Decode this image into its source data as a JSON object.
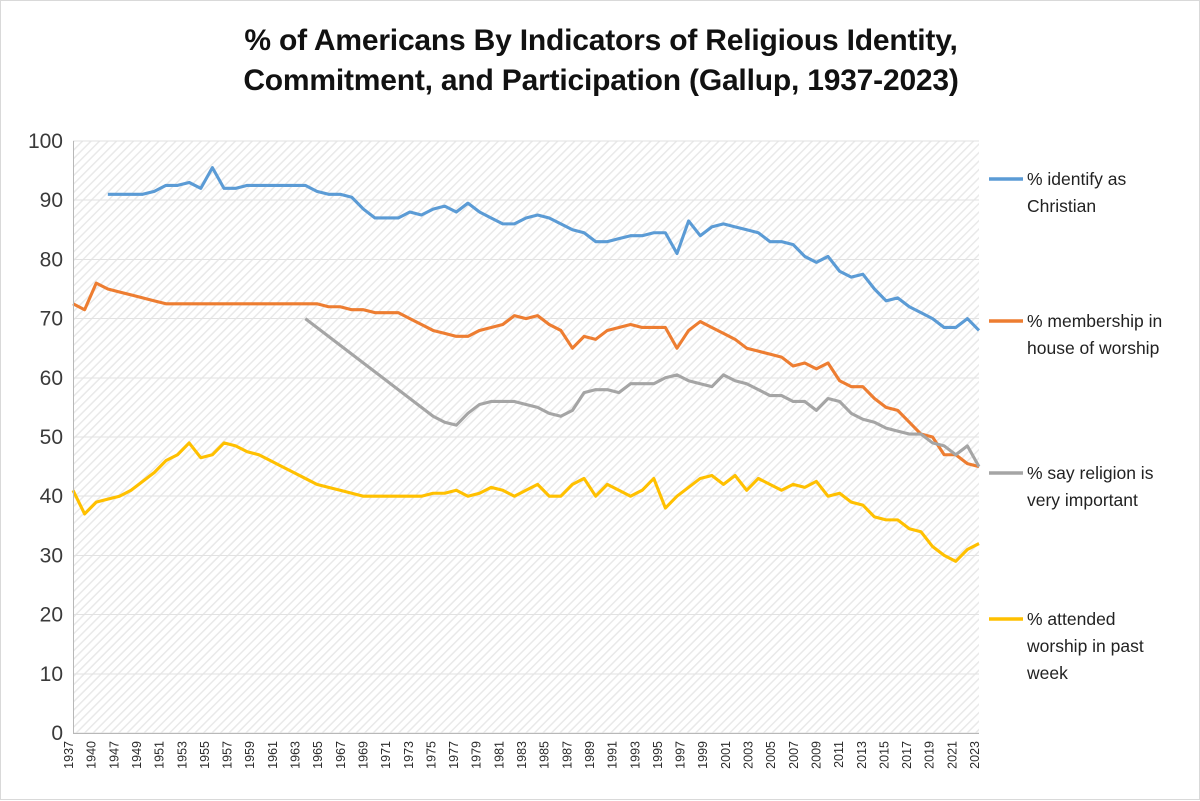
{
  "chart_data": {
    "type": "line",
    "title": "% of Americans By Indicators of Religious Identity,\nCommitment, and Participation (Gallup, 1937-2023)",
    "title_line1": "% of Americans By Indicators of Religious Identity,",
    "title_line2": "Commitment, and Participation (Gallup, 1937-2023)",
    "xlabel": "",
    "ylabel": "",
    "ylim": [
      0,
      100
    ],
    "ytick_step": 10,
    "yticks": [
      "0",
      "10",
      "20",
      "30",
      "40",
      "50",
      "60",
      "70",
      "80",
      "90",
      "100"
    ],
    "grid": true,
    "legend_position": "right",
    "background_pattern": "diagonal-hatch",
    "x_tick_labels": [
      "1937",
      "1940",
      "1947",
      "1949",
      "1951",
      "1953",
      "1955",
      "1957",
      "1959",
      "1961",
      "1963",
      "1965",
      "1967",
      "1969",
      "1971",
      "1973",
      "1975",
      "1977",
      "1979",
      "1981",
      "1983",
      "1985",
      "1987",
      "1989",
      "1991",
      "1993",
      "1995",
      "1997",
      "1999",
      "2001",
      "2003",
      "2005",
      "2007",
      "2009",
      "2011",
      "2013",
      "2015",
      "2017",
      "2019",
      "2021",
      "2023"
    ],
    "x": [
      1937,
      1940,
      1947,
      1948,
      1949,
      1950,
      1951,
      1952,
      1953,
      1954,
      1955,
      1956,
      1957,
      1958,
      1959,
      1960,
      1961,
      1962,
      1963,
      1964,
      1965,
      1966,
      1967,
      1968,
      1969,
      1970,
      1971,
      1972,
      1973,
      1974,
      1975,
      1976,
      1977,
      1978,
      1979,
      1980,
      1981,
      1982,
      1983,
      1984,
      1985,
      1986,
      1987,
      1988,
      1989,
      1990,
      1991,
      1992,
      1993,
      1994,
      1995,
      1996,
      1997,
      1998,
      1999,
      2000,
      2001,
      2002,
      2003,
      2004,
      2005,
      2006,
      2007,
      2008,
      2009,
      2010,
      2011,
      2012,
      2013,
      2014,
      2015,
      2016,
      2017,
      2018,
      2019,
      2020,
      2021,
      2022,
      2023
    ],
    "series": [
      {
        "name": "% identify as Christian",
        "color": "#5B9BD5",
        "x_start": 1948,
        "values": [
          null,
          null,
          null,
          91,
          91,
          91,
          91,
          91.5,
          92.5,
          92.5,
          93,
          92,
          95.5,
          92,
          92,
          92.5,
          92.5,
          92.5,
          92.5,
          92.5,
          92.5,
          91.5,
          91,
          91,
          90.5,
          88.5,
          87,
          87,
          87,
          88,
          87.5,
          88.5,
          89,
          88,
          89.5,
          88,
          87,
          86,
          86,
          87,
          87.5,
          87,
          86,
          85,
          84.5,
          83,
          83,
          83.5,
          84,
          84,
          84.5,
          84.5,
          81,
          86.5,
          84,
          85.5,
          86,
          85.5,
          85,
          84.5,
          83,
          83,
          82.5,
          80.5,
          79.5,
          80.5,
          78,
          77,
          77.5,
          75,
          73,
          73.5,
          72,
          71,
          70,
          68.5,
          68.5,
          70,
          68
        ]
      },
      {
        "name": "% membership in house of worship",
        "color": "#ED7D31",
        "x_start": 1937,
        "values": [
          72.5,
          71.5,
          76,
          75,
          74.5,
          74,
          73.5,
          73,
          72.5,
          72.5,
          72.5,
          72.5,
          72.5,
          72.5,
          72.5,
          72.5,
          72.5,
          72.5,
          72.5,
          72.5,
          72.5,
          72.5,
          72,
          72,
          71.5,
          71.5,
          71,
          71,
          71,
          70,
          69,
          68,
          67.5,
          67,
          67,
          68,
          68.5,
          69,
          70.5,
          70,
          70.5,
          69,
          68,
          65,
          67,
          66.5,
          68,
          68.5,
          69,
          68.5,
          68.5,
          68.5,
          65,
          68,
          69.5,
          68.5,
          67.5,
          66.5,
          65,
          64.5,
          64,
          63.5,
          62,
          62.5,
          61.5,
          62.5,
          59.5,
          58.5,
          58.5,
          56.5,
          55,
          54.5,
          52.5,
          50.5,
          50,
          47,
          47,
          45.5,
          45
        ]
      },
      {
        "name": "% say religion is very important",
        "color": "#A5A5A5",
        "x_start": 1965,
        "values": [
          null,
          null,
          null,
          null,
          null,
          null,
          null,
          null,
          null,
          null,
          null,
          null,
          null,
          null,
          null,
          null,
          null,
          null,
          null,
          null,
          70,
          68.5,
          67,
          65.5,
          64,
          62.5,
          61,
          59.5,
          58,
          56.5,
          55,
          53.5,
          52.5,
          52,
          54,
          55.5,
          56,
          56,
          56,
          55.5,
          55,
          54,
          53.5,
          54.5,
          57.5,
          58,
          58,
          57.5,
          59,
          59,
          59,
          60,
          60.5,
          59.5,
          59,
          58.5,
          60.5,
          59.5,
          59,
          58,
          57,
          57,
          56,
          56,
          54.5,
          56.5,
          56,
          54,
          53,
          52.5,
          51.5,
          51,
          50.5,
          50.5,
          49,
          48.5,
          47,
          48.5,
          45
        ]
      },
      {
        "name": "% attended worship in past week",
        "color": "#FFC000",
        "x_start": 1937,
        "values": [
          41,
          37,
          39,
          39.5,
          40,
          41,
          42.5,
          44,
          46,
          47,
          49,
          46.5,
          47,
          49,
          48.5,
          47.5,
          47,
          46,
          45,
          44,
          43,
          42,
          41.5,
          41,
          40.5,
          40,
          40,
          40,
          40,
          40,
          40,
          40.5,
          40.5,
          41,
          40,
          40.5,
          41.5,
          41,
          40,
          41,
          42,
          40,
          40,
          42,
          43,
          40,
          42,
          41,
          40,
          41,
          43,
          38,
          40,
          41.5,
          43,
          43.5,
          42,
          43.5,
          41,
          43,
          42,
          41,
          42,
          41.5,
          42.5,
          40,
          40.5,
          39,
          38.5,
          36.5,
          36,
          36,
          34.5,
          34,
          31.5,
          30,
          29,
          31,
          32
        ]
      }
    ]
  },
  "legend": [
    {
      "label_line1": "% identify as",
      "label_line2": "Christian",
      "label_line3": "",
      "color": "#5B9BD5"
    },
    {
      "label_line1": "% membership in",
      "label_line2": "house of worship",
      "label_line3": "",
      "color": "#ED7D31"
    },
    {
      "label_line1": "% say religion is",
      "label_line2": "very important",
      "label_line3": "",
      "color": "#A5A5A5"
    },
    {
      "label_line1": "% attended",
      "label_line2": "worship in past",
      "label_line3": "week",
      "color": "#FFC000"
    }
  ]
}
